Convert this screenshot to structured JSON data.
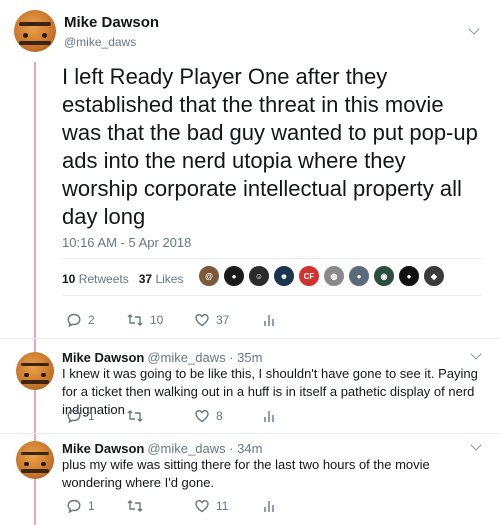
{
  "main_tweet": {
    "name": "Mike Dawson",
    "handle": "@mike_daws",
    "text": "I left Ready Player One after they established that the threat in this movie was that the bad guy wanted to put pop-up ads into the nerd utopia where they worship corporate intellectual property all day long",
    "timestamp": "10:16 AM - 5 Apr 2018",
    "retweets_count": "10",
    "retweets_label": "Retweets",
    "likes_count": "37",
    "likes_label": "Likes",
    "likers": [
      {
        "color": "#7a5a3a",
        "glyph": "@"
      },
      {
        "color": "#1a1a1a",
        "glyph": "●"
      },
      {
        "color": "#2b2b2b",
        "glyph": "☺"
      },
      {
        "color": "#1b3550",
        "glyph": "☻"
      },
      {
        "color": "#d3312b",
        "glyph": "CF"
      },
      {
        "color": "#8a8a8a",
        "glyph": "◍"
      },
      {
        "color": "#5a6a7a",
        "glyph": "●"
      },
      {
        "color": "#2c4f3d",
        "glyph": "◉"
      },
      {
        "color": "#111111",
        "glyph": "●"
      },
      {
        "color": "#3a3a3a",
        "glyph": "◆"
      }
    ],
    "actions": {
      "reply": "2",
      "retweet": "10",
      "like": "37"
    }
  },
  "replies": [
    {
      "name": "Mike Dawson",
      "handle": "@mike_daws · 35m",
      "text": "I knew it was going to be like this, I shouldn't have gone to see it. Paying for a ticket then walking out in a huff is in itself a pathetic display of nerd indignation",
      "actions": {
        "reply": "1",
        "retweet": "",
        "like": "8"
      }
    },
    {
      "name": "Mike Dawson",
      "handle": "@mike_daws · 34m",
      "text": "plus my wife was sitting there for the last two hours of the movie wondering where I'd gone.",
      "actions": {
        "reply": "1",
        "retweet": "",
        "like": "11"
      }
    }
  ],
  "colors": {
    "thread_line": "#e6a6c6",
    "muted": "#657786",
    "text": "#14171a"
  }
}
